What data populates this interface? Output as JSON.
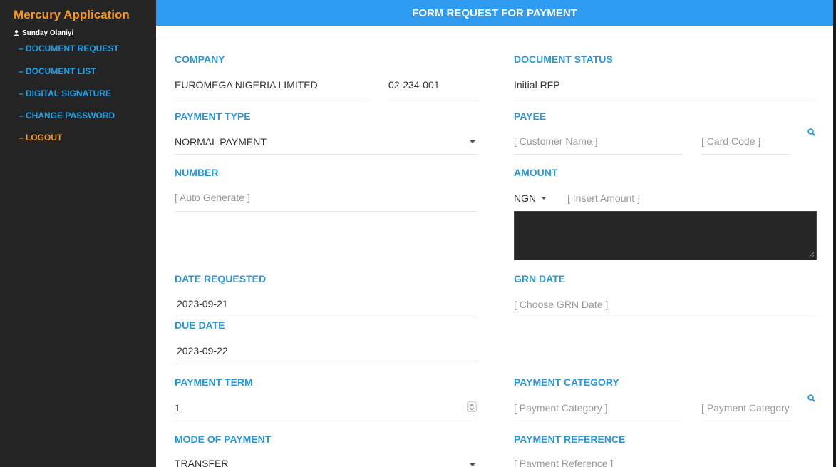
{
  "sidebar": {
    "app_title": "Mercury Application",
    "user_name": "Sunday Olaniyi",
    "items": [
      {
        "label": "– DOCUMENT REQUEST"
      },
      {
        "label": "– DOCUMENT LIST"
      },
      {
        "label": "– DIGITAL SIGNATURE"
      },
      {
        "label": "– CHANGE PASSWORD"
      },
      {
        "label": "– LOGOUT"
      }
    ]
  },
  "header": {
    "title": "FORM REQUEST FOR PAYMENT"
  },
  "form": {
    "company": {
      "label": "COMPANY",
      "name": "EUROMEGA NIGERIA LIMITED",
      "code": "02-234-001"
    },
    "document_status": {
      "label": "DOCUMENT STATUS",
      "value": "Initial RFP"
    },
    "payment_type": {
      "label": "PAYMENT TYPE",
      "value": "NORMAL PAYMENT"
    },
    "payee": {
      "label": "PAYEE",
      "customer_placeholder": "[ Customer Name ]",
      "card_placeholder": "[ Card Code ]"
    },
    "number": {
      "label": "NUMBER",
      "placeholder": "[ Auto Generate ]"
    },
    "amount": {
      "label": "AMOUNT",
      "currency": "NGN",
      "placeholder": "[ Insert Amount ]"
    },
    "date_requested": {
      "label": "DATE REQUESTED",
      "value": "2023-09-21"
    },
    "grn_date": {
      "label": "GRN DATE",
      "placeholder": "[ Choose GRN Date ]"
    },
    "due_date": {
      "label": "DUE DATE",
      "value": "2023-09-22"
    },
    "payment_term": {
      "label": "PAYMENT TERM",
      "value": "1"
    },
    "payment_category": {
      "label": "PAYMENT CATEGORY",
      "placeholder1": "[ Payment Category ]",
      "placeholder2": "[ Payment Category"
    },
    "mode_of_payment": {
      "label": "MODE OF PAYMENT",
      "value": "TRANSFER"
    },
    "payment_reference": {
      "label": "PAYMENT REFERENCE",
      "placeholder": "[ Payment Reference ]"
    }
  },
  "colors": {
    "accent": "#2e9bf0",
    "label_blue": "#2c97d3",
    "brand_orange": "#f7941d",
    "sidebar_bg": "#242424"
  }
}
